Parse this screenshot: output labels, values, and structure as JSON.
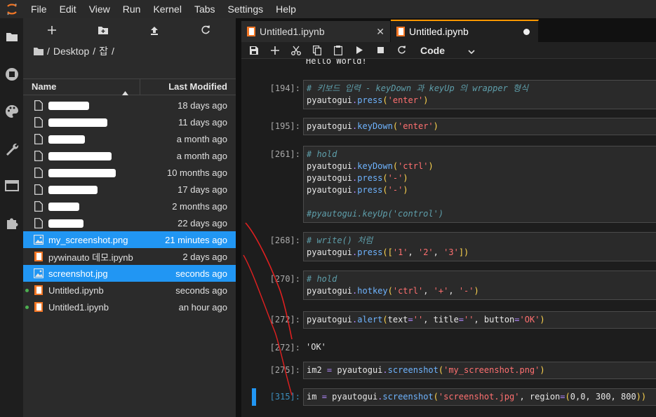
{
  "menubar": {
    "items": [
      "File",
      "Edit",
      "View",
      "Run",
      "Kernel",
      "Tabs",
      "Settings",
      "Help"
    ]
  },
  "activity_icons": [
    "folder-icon",
    "running-icon",
    "palette-icon",
    "wrench-icon",
    "tabs-icon",
    "extension-icon"
  ],
  "filebrowser": {
    "toolbar_icons": [
      "new-launcher-icon",
      "new-folder-icon",
      "upload-icon",
      "refresh-icon"
    ],
    "breadcrumb": [
      "/",
      "Desktop",
      "/",
      "잡",
      "/"
    ],
    "header": {
      "name": "Name",
      "modified": "Last Modified"
    },
    "files": [
      {
        "name": "",
        "redacted": true,
        "type": "file",
        "modified": "18 days ago",
        "selected": false,
        "running": false
      },
      {
        "name": "",
        "redacted": true,
        "type": "file",
        "modified": "11 days ago",
        "selected": false,
        "running": false
      },
      {
        "name": "",
        "redacted": true,
        "type": "file",
        "modified": "a month ago",
        "selected": false,
        "running": false
      },
      {
        "name": "",
        "redacted": true,
        "type": "file",
        "modified": "a month ago",
        "selected": false,
        "running": false
      },
      {
        "name": "",
        "redacted": true,
        "type": "file",
        "modified": "10 months ago",
        "selected": false,
        "running": false
      },
      {
        "name": "",
        "redacted": true,
        "type": "file",
        "modified": "17 days ago",
        "selected": false,
        "running": false
      },
      {
        "name": "",
        "redacted": true,
        "type": "file",
        "modified": "2 months ago",
        "selected": false,
        "running": false
      },
      {
        "name": "",
        "redacted": true,
        "type": "file",
        "modified": "22 days ago",
        "selected": false,
        "running": false
      },
      {
        "name": "my_screenshot.png",
        "redacted": false,
        "type": "image",
        "modified": "21 minutes ago",
        "selected": true,
        "running": false
      },
      {
        "name": "pywinauto 데모.ipynb",
        "redacted": false,
        "type": "notebook",
        "modified": "2 days ago",
        "selected": false,
        "running": false
      },
      {
        "name": "screenshot.jpg",
        "redacted": false,
        "type": "image",
        "modified": "seconds ago",
        "selected": true,
        "running": false
      },
      {
        "name": "Untitled.ipynb",
        "redacted": false,
        "type": "notebook",
        "modified": "seconds ago",
        "selected": false,
        "running": true
      },
      {
        "name": "Untitled1.ipynb",
        "redacted": false,
        "type": "notebook",
        "modified": "an hour ago",
        "selected": false,
        "running": true
      }
    ]
  },
  "tabs": [
    {
      "label": "Untitled1.ipynb",
      "active": false
    },
    {
      "label": "Untitled.ipynb",
      "active": true
    }
  ],
  "notebook_toolbar": {
    "icons": [
      "save-icon",
      "insert-cell-icon",
      "cut-icon",
      "copy-icon",
      "paste-icon",
      "run-icon",
      "stop-icon",
      "restart-icon"
    ],
    "cell_type": "Code"
  },
  "cells": [
    {
      "prompt": "",
      "kind": "output",
      "lines": [
        [
          [
            "n",
            "Hello World!"
          ]
        ]
      ]
    },
    {
      "prompt": "[194]:",
      "kind": "code",
      "lines": [
        [
          [
            "c",
            "# 키보드 입력 - keyDown 과 keyUp 의 wrapper 형식"
          ]
        ],
        [
          [
            "n",
            "pyautogui"
          ],
          [
            "o",
            "."
          ],
          [
            "f",
            "press"
          ],
          [
            "p",
            "("
          ],
          [
            "s",
            "'enter'"
          ],
          [
            "p",
            ")"
          ]
        ]
      ]
    },
    {
      "prompt": "[195]:",
      "kind": "code",
      "lines": [
        [
          [
            "n",
            "pyautogui"
          ],
          [
            "o",
            "."
          ],
          [
            "f",
            "keyDown"
          ],
          [
            "p",
            "("
          ],
          [
            "s",
            "'enter'"
          ],
          [
            "p",
            ")"
          ]
        ]
      ]
    },
    {
      "prompt": "[261]:",
      "kind": "code",
      "lines": [
        [
          [
            "c",
            "# hold"
          ]
        ],
        [
          [
            "n",
            "pyautogui"
          ],
          [
            "o",
            "."
          ],
          [
            "f",
            "keyDown"
          ],
          [
            "p",
            "("
          ],
          [
            "s",
            "'ctrl'"
          ],
          [
            "p",
            ")"
          ]
        ],
        [
          [
            "n",
            "pyautogui"
          ],
          [
            "o",
            "."
          ],
          [
            "f",
            "press"
          ],
          [
            "p",
            "("
          ],
          [
            "s",
            "'-'"
          ],
          [
            "p",
            ")"
          ]
        ],
        [
          [
            "n",
            "pyautogui"
          ],
          [
            "o",
            "."
          ],
          [
            "f",
            "press"
          ],
          [
            "p",
            "("
          ],
          [
            "s",
            "'-'"
          ],
          [
            "p",
            ")"
          ]
        ],
        [
          [
            "n",
            ""
          ]
        ],
        [
          [
            "c",
            "#pyautogui.keyUp('control')"
          ]
        ]
      ]
    },
    {
      "prompt": "[268]:",
      "kind": "code",
      "lines": [
        [
          [
            "c",
            "# write() 처럼"
          ]
        ],
        [
          [
            "n",
            "pyautogui"
          ],
          [
            "o",
            "."
          ],
          [
            "f",
            "press"
          ],
          [
            "p",
            "(["
          ],
          [
            "s",
            "'1'"
          ],
          [
            "n",
            ", "
          ],
          [
            "s",
            "'2'"
          ],
          [
            "n",
            ", "
          ],
          [
            "s",
            "'3'"
          ],
          [
            "p",
            "])"
          ]
        ]
      ]
    },
    {
      "prompt": "[270]:",
      "kind": "code",
      "lines": [
        [
          [
            "c",
            "# hold"
          ]
        ],
        [
          [
            "n",
            "pyautogui"
          ],
          [
            "o",
            "."
          ],
          [
            "f",
            "hotkey"
          ],
          [
            "p",
            "("
          ],
          [
            "s",
            "'ctrl'"
          ],
          [
            "n",
            ", "
          ],
          [
            "s",
            "'+'"
          ],
          [
            "n",
            ", "
          ],
          [
            "s",
            "'-'"
          ],
          [
            "p",
            ")"
          ]
        ]
      ]
    },
    {
      "prompt": "[272]:",
      "kind": "code",
      "lines": [
        [
          [
            "n",
            "pyautogui"
          ],
          [
            "o",
            "."
          ],
          [
            "f",
            "alert"
          ],
          [
            "p",
            "("
          ],
          [
            "n",
            "text"
          ],
          [
            "o",
            "="
          ],
          [
            "s",
            "''"
          ],
          [
            "n",
            ", title"
          ],
          [
            "o",
            "="
          ],
          [
            "s",
            "''"
          ],
          [
            "n",
            ", button"
          ],
          [
            "o",
            "="
          ],
          [
            "s",
            "'OK'"
          ],
          [
            "p",
            ")"
          ]
        ]
      ]
    },
    {
      "prompt": "[272]:",
      "kind": "output",
      "lines": [
        [
          [
            "n",
            "'OK'"
          ]
        ]
      ]
    },
    {
      "prompt": "[275]:",
      "kind": "code",
      "lines": [
        [
          [
            "n",
            "im2 "
          ],
          [
            "o",
            "="
          ],
          [
            "n",
            " pyautogui"
          ],
          [
            "o",
            "."
          ],
          [
            "f",
            "screenshot"
          ],
          [
            "p",
            "("
          ],
          [
            "s",
            "'my_screenshot.png'"
          ],
          [
            "p",
            ")"
          ]
        ]
      ]
    },
    {
      "prompt": "[315]:",
      "kind": "code",
      "active": true,
      "lines": [
        [
          [
            "n",
            "im "
          ],
          [
            "o",
            "="
          ],
          [
            "n",
            " pyautogui"
          ],
          [
            "o",
            "."
          ],
          [
            "f",
            "screenshot"
          ],
          [
            "p",
            "("
          ],
          [
            "s",
            "'screenshot.jpg'"
          ],
          [
            "n",
            ", region"
          ],
          [
            "o",
            "="
          ],
          [
            "p",
            "("
          ],
          [
            "n",
            "0,0, 300, 800"
          ],
          [
            "p",
            "))"
          ]
        ]
      ]
    }
  ]
}
